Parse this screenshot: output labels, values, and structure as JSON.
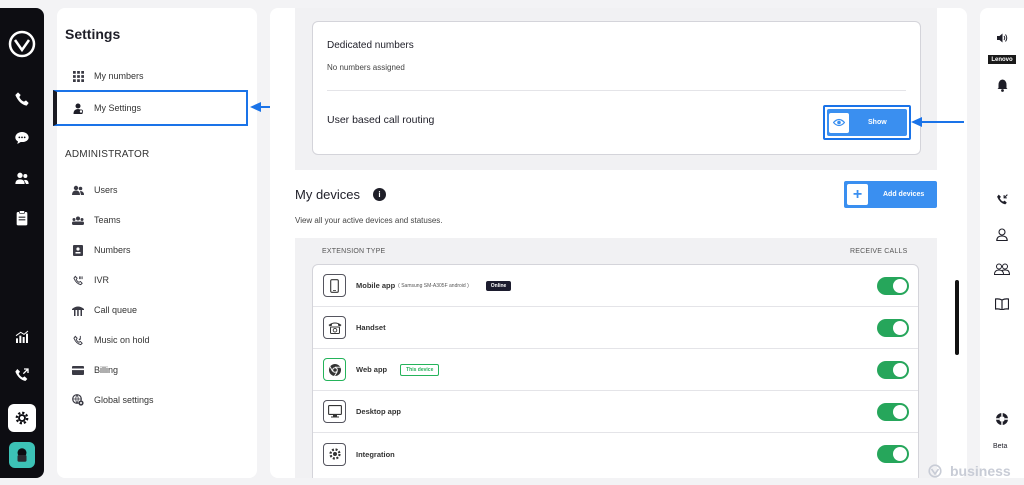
{
  "left_rail": {
    "icons": [
      "logo-icon",
      "phone-icon",
      "chat-icon",
      "contacts-icon",
      "clipboard-icon",
      "analytics-icon",
      "call-forward-icon",
      "gear-icon",
      "avatar"
    ]
  },
  "settings": {
    "title": "Settings",
    "items": [
      {
        "label": "My numbers",
        "icon": "grid-icon"
      },
      {
        "label": "My Settings",
        "icon": "user-icon",
        "active": true
      }
    ],
    "admin_heading": "ADMINISTRATOR",
    "admin_items": [
      {
        "label": "Users",
        "icon": "users-icon"
      },
      {
        "label": "Teams",
        "icon": "teams-icon"
      },
      {
        "label": "Numbers",
        "icon": "numbers-icon"
      },
      {
        "label": "IVR",
        "icon": "ivr-icon"
      },
      {
        "label": "Call queue",
        "icon": "call-queue-icon"
      },
      {
        "label": "Music on hold",
        "icon": "music-icon"
      },
      {
        "label": "Billing",
        "icon": "billing-icon"
      },
      {
        "label": "Global settings",
        "icon": "globe-gear-icon"
      }
    ]
  },
  "main": {
    "dedicated_title": "Dedicated numbers",
    "dedicated_sub": "No numbers assigned",
    "routing_title": "User based call routing",
    "show_label": "Show",
    "devices_title": "My devices",
    "devices_info": "i",
    "devices_sub": "View all your active devices and statuses.",
    "add_devices_label": "Add devices",
    "col_extension": "EXTENSION TYPE",
    "col_receive": "RECEIVE CALLS",
    "devices": [
      {
        "name": "Mobile app",
        "detail": "( Samsung SM-A305F android )",
        "badge": "Online",
        "icon": "mobile-icon",
        "receive_calls": true
      },
      {
        "name": "Handset",
        "icon": "handset-icon",
        "receive_calls": true
      },
      {
        "name": "Web app",
        "badge": "This device",
        "icon": "chrome-icon",
        "receive_calls": true
      },
      {
        "name": "Desktop app",
        "icon": "desktop-icon",
        "receive_calls": true
      },
      {
        "name": "Integration",
        "icon": "integration-icon",
        "receive_calls": true
      }
    ]
  },
  "right_rail": {
    "lenovo_label": "Lenovo",
    "beta_label": "Beta",
    "icons": [
      "speaker-icon",
      "bell-icon",
      "incoming-call-icon",
      "person-icon",
      "group-icon",
      "book-icon",
      "lifebuoy-icon"
    ]
  },
  "watermark": "business",
  "colors": {
    "accent": "#3a8ff0",
    "highlight": "#1a73e8",
    "toggle_on": "#26a65b",
    "rail": "#0d0d12"
  }
}
